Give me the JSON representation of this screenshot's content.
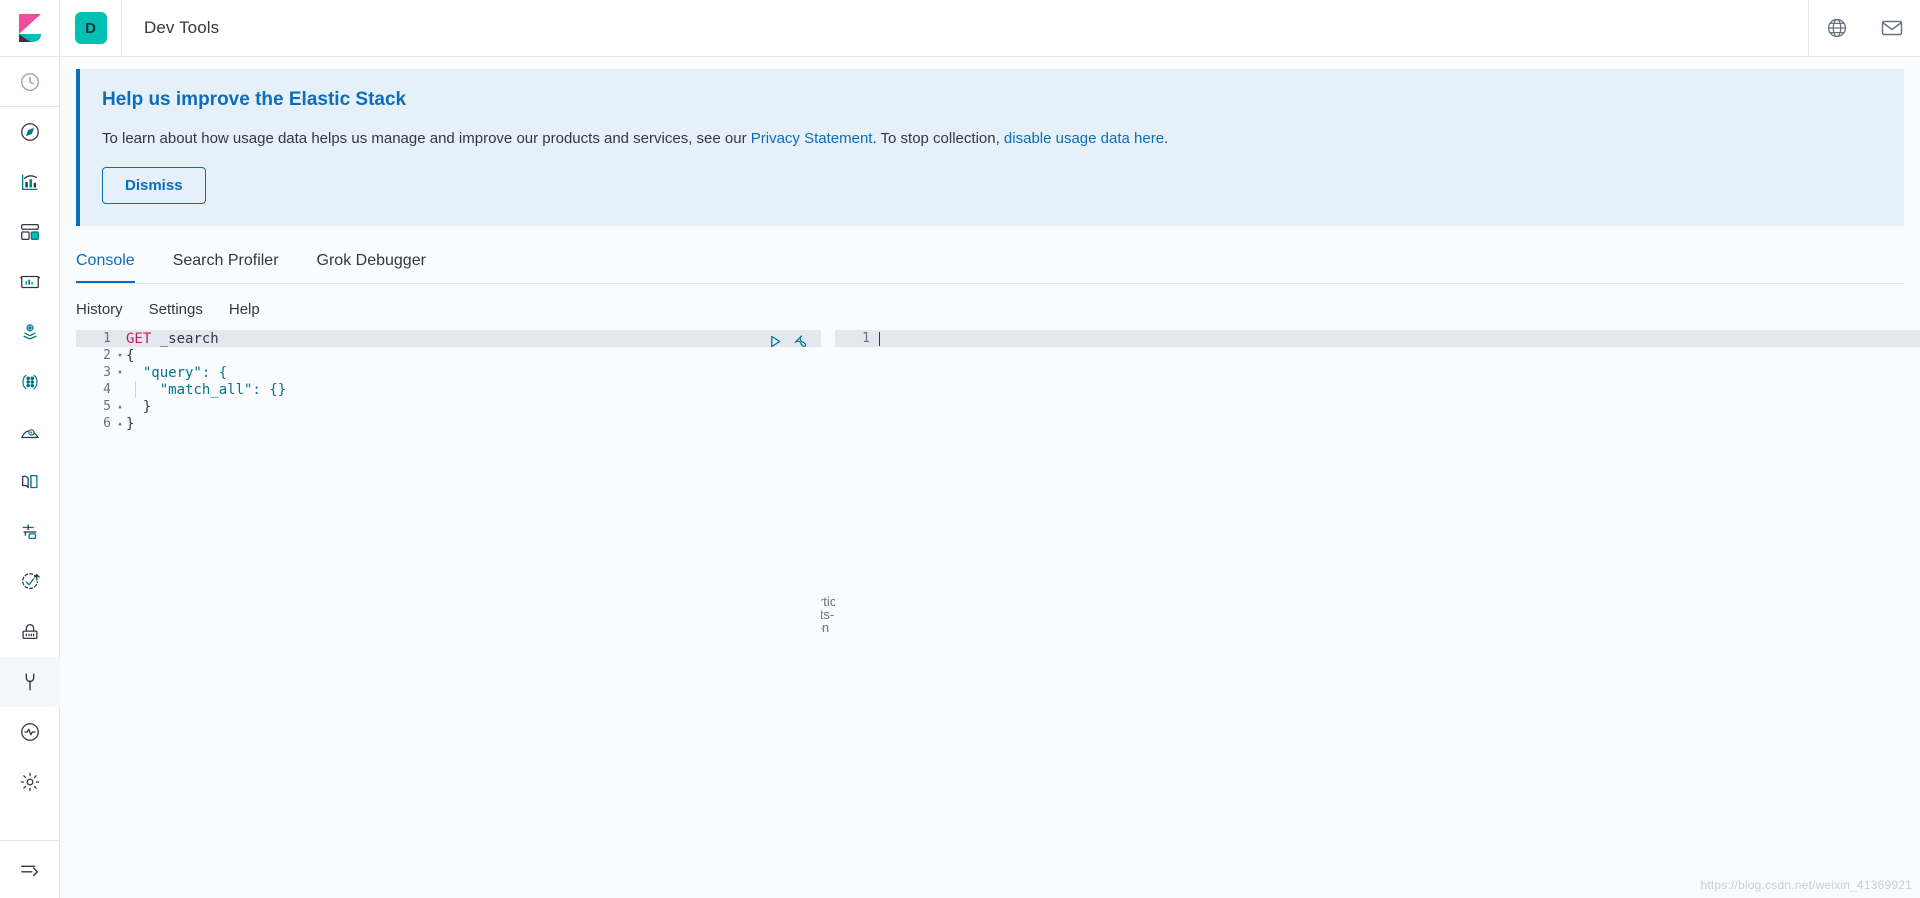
{
  "brand": {
    "logo": "kibana-logo"
  },
  "topbar": {
    "space_badge": "D",
    "title": "Dev Tools",
    "help_icon": "help-circle-icon",
    "mail_icon": "mail-icon"
  },
  "sidebar": {
    "items": [
      {
        "name": "recently-viewed",
        "icon": "clock-icon",
        "label": "Recently viewed",
        "active": false
      },
      {
        "name": "discover",
        "icon": "compass-icon",
        "label": "Discover",
        "active": false
      },
      {
        "name": "visualize",
        "icon": "bar-chart-icon",
        "label": "Visualize",
        "active": false
      },
      {
        "name": "dashboard",
        "icon": "dashboard-icon",
        "label": "Dashboard",
        "active": false
      },
      {
        "name": "canvas",
        "icon": "canvas-icon",
        "label": "Canvas",
        "active": false
      },
      {
        "name": "maps",
        "icon": "map-marker-layers-icon",
        "label": "Maps",
        "active": false
      },
      {
        "name": "machine-learning",
        "icon": "machine-learning-icon",
        "label": "Machine Learning",
        "active": false
      },
      {
        "name": "infrastructure",
        "icon": "infrastructure-icon",
        "label": "Infrastructure",
        "active": false
      },
      {
        "name": "logs",
        "icon": "logs-icon",
        "label": "Logs",
        "active": false
      },
      {
        "name": "apm",
        "icon": "apm-icon",
        "label": "APM",
        "active": false
      },
      {
        "name": "uptime",
        "icon": "uptime-icon",
        "label": "Uptime",
        "active": false
      },
      {
        "name": "siem",
        "icon": "lock-icon",
        "label": "SIEM",
        "active": false
      },
      {
        "name": "dev-tools",
        "icon": "wrench-icon",
        "label": "Dev Tools",
        "active": true
      },
      {
        "name": "monitoring",
        "icon": "heart-pulse-icon",
        "label": "Monitoring",
        "active": false
      },
      {
        "name": "management",
        "icon": "gear-icon",
        "label": "Management",
        "active": false
      }
    ],
    "collapse": {
      "icon": "collapse-arrow-icon",
      "label": "Collapse"
    }
  },
  "callout": {
    "title": "Help us improve the Elastic Stack",
    "text_before": "To learn about how usage data helps us manage and improve our products and services, see our ",
    "link_privacy": "Privacy Statement",
    "text_middle": ". To stop collection, ",
    "link_disable": "disable usage data here",
    "text_after": ".",
    "dismiss_label": "Dismiss",
    "accent_color": "#0a6ebc",
    "background_color": "#e6f0f8"
  },
  "tabs": [
    {
      "label": "Console",
      "active": true
    },
    {
      "label": "Search Profiler",
      "active": false
    },
    {
      "label": "Grok Debugger",
      "active": false
    }
  ],
  "console_menu": [
    {
      "label": "History"
    },
    {
      "label": "Settings"
    },
    {
      "label": "Help"
    }
  ],
  "editor": {
    "actions": [
      {
        "name": "send-request-button",
        "icon": "play-icon"
      },
      {
        "name": "wrench-menu-button",
        "icon": "wrench-icon"
      }
    ],
    "lines": [
      {
        "num": "1",
        "fold": "",
        "method": "GET",
        "url": " _search",
        "highlight": true
      },
      {
        "num": "2",
        "fold": "▾",
        "text": "{",
        "highlight": false
      },
      {
        "num": "3",
        "fold": "▾",
        "text": "  \"query\": {",
        "highlight": false
      },
      {
        "num": "4",
        "fold": "",
        "text": "    \"match_all\": {}",
        "highlight": false,
        "guide": true
      },
      {
        "num": "5",
        "fold": "▴",
        "text": "  }",
        "highlight": false
      },
      {
        "num": "6",
        "fold": "▴",
        "text": "}",
        "highlight": false
      }
    ],
    "drag_handle_icon": "vertical-dots-icon"
  },
  "response": {
    "line_number": "1",
    "content": ""
  },
  "watermark": "https://blog.csdn.net/weixin_41369921"
}
